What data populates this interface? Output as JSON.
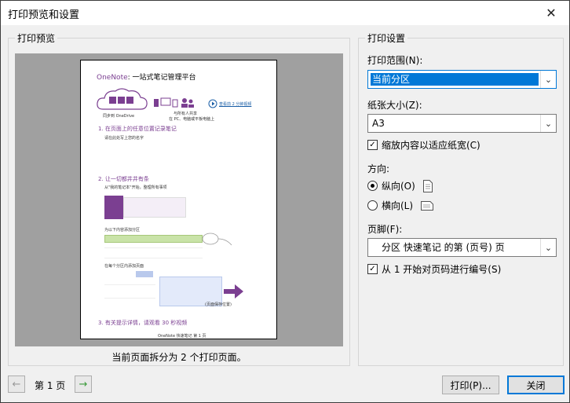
{
  "window": {
    "title": "打印预览和设置",
    "close_glyph": "✕"
  },
  "preview": {
    "group_label": "打印预览",
    "caption": "当前页面拆分为 2 个打印页面。",
    "page": {
      "title_brand": "OneNote",
      "title_rest": ": 一站式笔记管理平台",
      "sync_caption": "同步到 OneDrive",
      "share_caption_1": "与所有人共享",
      "share_caption_2": "在 PC、电脑或平板电脑上",
      "video_link": "查看前 2 分钟视频",
      "step1": "1. 在页面上的任意位置记录笔记",
      "step1_sub": "请在此处写上您的名字",
      "step2": "2. 让一切都井井有条",
      "step2_sub": "从\"我的笔记本\"开始，整理所有事项",
      "section_hint": "为以下内容添加分区",
      "page_hint": "在每个分区内添加页面",
      "organize_hint": "(页面保存位置)",
      "step3": "3. 有关提示详情，请观看 30 秒视频",
      "footer": "OneNote 快速笔记 第 1 页"
    }
  },
  "settings": {
    "group_label": "打印设置",
    "range_label": "打印范围(N):",
    "range_value": "当前分区",
    "paper_label": "纸张大小(Z):",
    "paper_value": "A3",
    "fit_label": "缩放内容以适应纸宽(C)",
    "fit_checked": true,
    "orientation_label": "方向:",
    "portrait_label": "纵向(O)",
    "landscape_label": "横向(L)",
    "footer_label": "页脚(F):",
    "footer_value": "分区 快速笔记 的第 (页号) 页",
    "numbering_label": "从 1 开始对页码进行编号(S)",
    "numbering_checked": true,
    "check_glyph": "✓",
    "dropdown_glyph": "⌄"
  },
  "nav": {
    "prev_glyph": "←",
    "next_glyph": "→",
    "page_label": "第 1 页"
  },
  "buttons": {
    "print": "打印(P)...",
    "close": "关闭"
  },
  "colors": {
    "accent": "#0078d7",
    "onenote_purple": "#7b3f91",
    "preview_bg": "#a0a0a0"
  }
}
